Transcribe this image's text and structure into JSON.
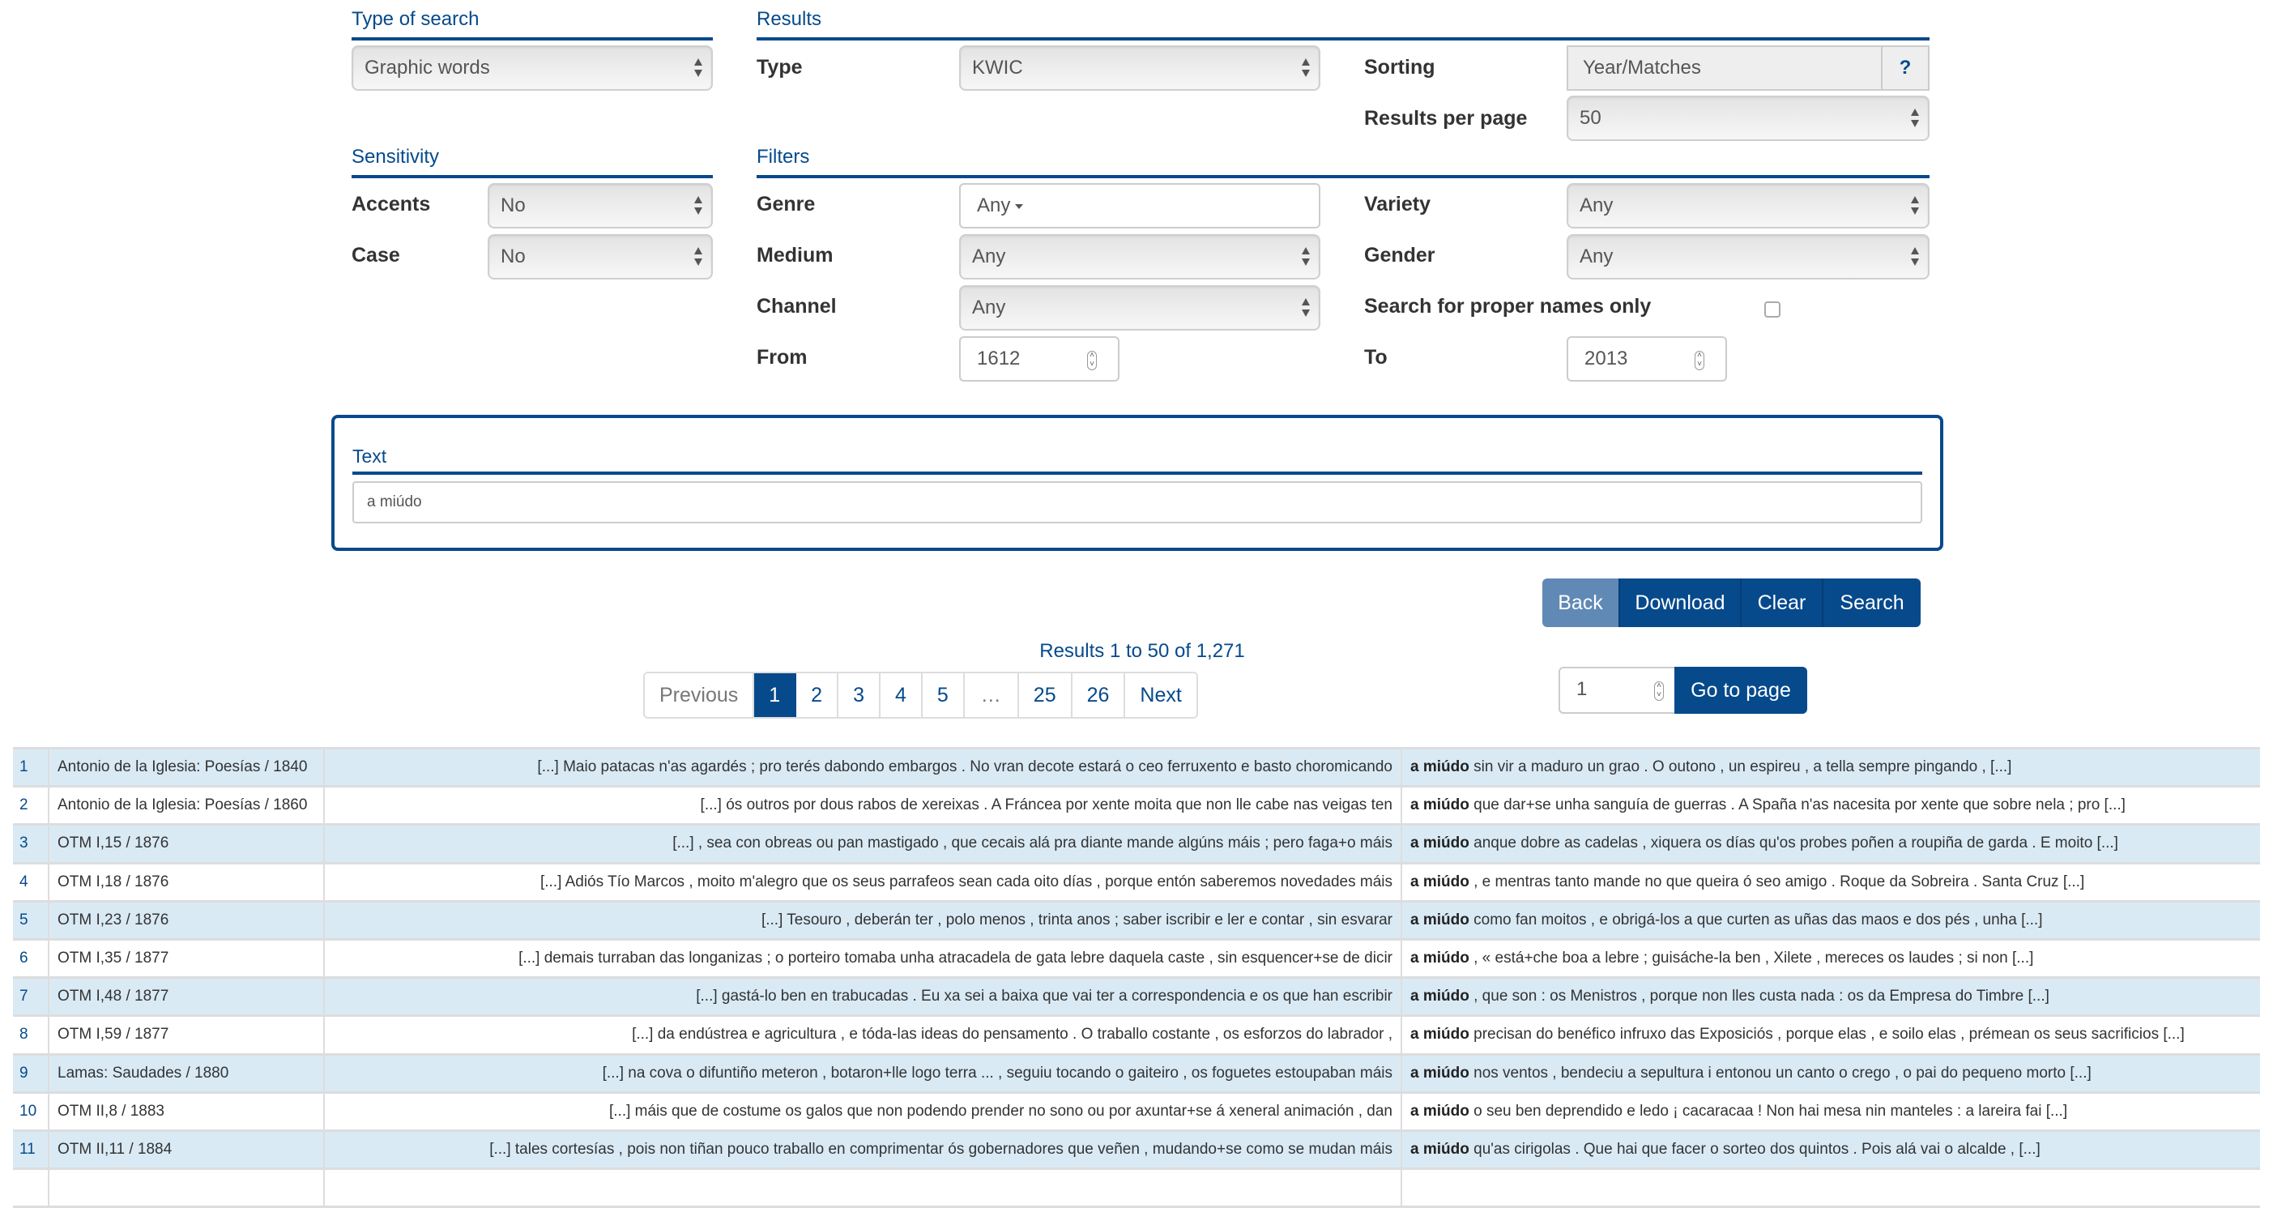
{
  "search_type": {
    "title": "Type of search",
    "value": "Graphic words"
  },
  "results_section": {
    "title": "Results",
    "type_label": "Type",
    "type_value": "KWIC",
    "sorting_label": "Sorting",
    "sorting_value": "Year/Matches",
    "help_label": "?",
    "per_page_label": "Results per page",
    "per_page_value": "50"
  },
  "sensitivity": {
    "title": "Sensitivity",
    "accents_label": "Accents",
    "accents_value": "No",
    "case_label": "Case",
    "case_value": "No"
  },
  "filters": {
    "title": "Filters",
    "genre_label": "Genre",
    "genre_value": "Any",
    "medium_label": "Medium",
    "medium_value": "Any",
    "channel_label": "Channel",
    "channel_value": "Any",
    "from_label": "From",
    "from_value": "1612",
    "variety_label": "Variety",
    "variety_value": "Any",
    "gender_label": "Gender",
    "gender_value": "Any",
    "proper_names_label": "Search for proper names only",
    "to_label": "To",
    "to_value": "2013"
  },
  "text_section": {
    "title": "Text",
    "value": "a miúdo"
  },
  "actions": {
    "back": "Back",
    "download": "Download",
    "clear": "Clear",
    "search": "Search"
  },
  "pagination": {
    "summary": "Results 1 to 50 of 1,271",
    "previous": "Previous",
    "pages": [
      "1",
      "2",
      "3",
      "4",
      "5",
      "…",
      "25",
      "26"
    ],
    "active_page": "1",
    "next": "Next",
    "goto_value": "1",
    "goto_label": "Go to page"
  },
  "keyword": "a miúdo",
  "rows": [
    {
      "n": "1",
      "source": "Antonio de la Iglesia: Poesías / 1840",
      "left": "[...] Maio patacas n'as agardés ; pro terés dabondo embargos . No vran decote estará o ceo ferruxento e basto choromicando",
      "right": "sin vir a maduro un grao . O outono , un espireu , a tella sempre pingando , [...]"
    },
    {
      "n": "2",
      "source": "Antonio de la Iglesia: Poesías / 1860",
      "left": "[...] ós outros por dous rabos de xereixas . A Fráncea por xente moita que non lle cabe nas veigas ten",
      "right": "que dar+se unha sanguía de guerras . A Spaña n'as nacesita por xente que sobre nela ; pro [...]"
    },
    {
      "n": "3",
      "source": "OTM I,15 / 1876",
      "left": "[...] , sea con obreas ou pan mastigado , que cecais alá pra diante mande algúns máis ; pero faga+o máis",
      "right": "anque dobre as cadelas , xiquera os días qu'os probes poñen a roupiña de garda . E moito [...]"
    },
    {
      "n": "4",
      "source": "OTM I,18 / 1876",
      "left": "[...] Adiós Tío Marcos , moito m'alegro que os seus parrafeos sean cada oito días , porque entón saberemos novedades máis",
      "right": ", e mentras tanto mande no que queira ó seo amigo . Roque da Sobreira . Santa Cruz [...]"
    },
    {
      "n": "5",
      "source": "OTM I,23 / 1876",
      "left": "[...] Tesouro , deberán ter , polo menos , trinta anos ; saber iscribir e ler e contar , sin esvarar",
      "right": "como fan moitos , e obrigá-los a que curten as uñas das maos e dos pés , unha [...]"
    },
    {
      "n": "6",
      "source": "OTM I,35 / 1877",
      "left": "[...] demais turraban das longanizas ; o porteiro tomaba unha atracadela de gata lebre daquela caste , sin esquencer+se de dicir",
      "right": ", « está+che boa a lebre ; guisáche-la ben , Xilete , mereces os laudes ; si non [...]"
    },
    {
      "n": "7",
      "source": "OTM I,48 / 1877",
      "left": "[...] gastá-lo ben en trabucadas . Eu xa sei a baixa que vai ter a correspondencia e os que han escribir",
      "right": ", que son : os Menistros , porque non lles custa nada : os da Empresa do Timbre [...]"
    },
    {
      "n": "8",
      "source": "OTM I,59 / 1877",
      "left": "[...] da endústrea e agricultura , e tóda-las ideas do pensamento . O traballo costante , os esforzos do labrador ,",
      "right": "precisan do benéfico infruxo das Exposiciós , porque elas , e soilo elas , prémean os seus sacrificios [...]"
    },
    {
      "n": "9",
      "source": "Lamas: Saudades / 1880",
      "left": "[...] na cova o difuntiño meteron , botaron+lle logo terra ... , seguiu tocando o gaiteiro , os foguetes estoupaban máis",
      "right": "nos ventos , bendeciu a sepultura i entonou un canto o crego , o pai do pequeno morto [...]"
    },
    {
      "n": "10",
      "source": "OTM II,8 / 1883",
      "left": "[...] máis que de costume os galos que non podendo prender no sono ou por axuntar+se á xeneral animación , dan",
      "right": "o seu ben deprendido e ledo ¡ cacaracaa ! Non hai mesa nin manteles : a lareira fai [...]"
    },
    {
      "n": "11",
      "source": "OTM II,11 / 1884",
      "left": "[...] tales cortesías , pois non tiñan pouco traballo en comprimentar ós gobernadores que veñen , mudando+se como se mudan máis",
      "right": "qu'as cirigolas . Que hai que facer o sorteo dos quintos . Pois alá vai o alcalde , [...]"
    },
    {
      "n": "",
      "source": "",
      "left": "",
      "right": ""
    }
  ]
}
